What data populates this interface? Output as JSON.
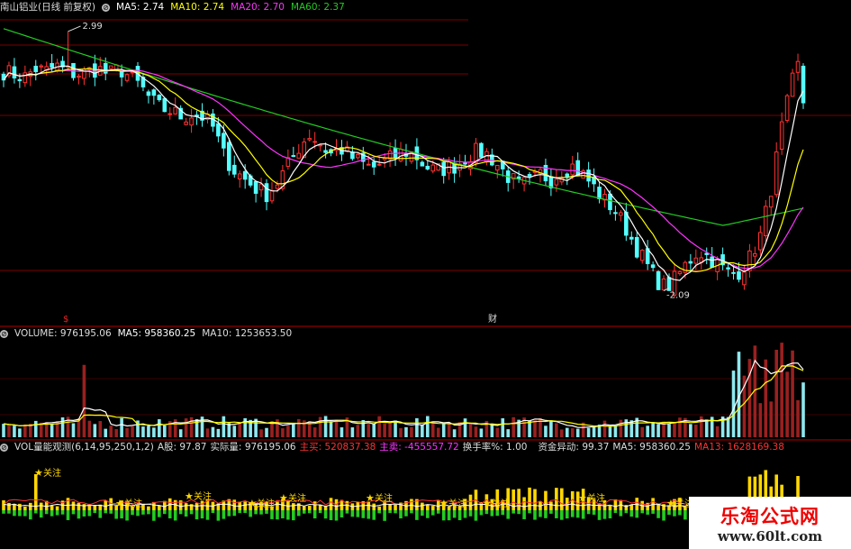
{
  "header_main": {
    "stock": "南山铝业(日线 前复权)",
    "ma5": "MA5: 2.74",
    "ma10": "MA10: 2.74",
    "ma20": "MA20: 2.70",
    "ma60": "MA60: 2.37"
  },
  "header_volume": {
    "label": "VOLUME: 976195.06",
    "ma5": "MA5: 958360.25",
    "ma10": "MA10: 1253653.50"
  },
  "header_indicator": {
    "label": "VOL量能观测(6,14,95,250,1,2)",
    "a": "A股: 97.87",
    "actual": "实际量: 976195.06",
    "main_buy": "主买: 520837.38",
    "main_sell": "主卖: -455557.72",
    "turnover": "换手率%: 1.00",
    "fund": "资金异动: 99.37",
    "ma5": "MA5: 958360.25",
    "ma13": "MA13: 1628169.38"
  },
  "colors": {
    "up": "#ff3232",
    "down": "#54ffff",
    "ma5": "#ffffff",
    "ma10": "#ffff00",
    "ma20": "#ff33ff",
    "ma60": "#22cc22",
    "grid": "#7a0000",
    "buy": "#ffd700",
    "sell": "#22cc22"
  },
  "chart_data": [
    {
      "type": "candlestick",
      "panel": "price",
      "title": "南山铝业(日线 前复权)",
      "series": [
        {
          "name": "MA5",
          "value": 2.74
        },
        {
          "name": "MA10",
          "value": 2.74
        },
        {
          "name": "MA20",
          "value": 2.7
        },
        {
          "name": "MA60",
          "value": 2.37
        }
      ],
      "annotations": [
        "2.99",
        "2.09",
        "$",
        "财"
      ],
      "close_path": [
        2.85,
        2.84,
        2.83,
        2.86,
        2.85,
        2.87,
        2.85,
        2.84,
        2.85,
        2.86,
        2.84,
        2.86,
        2.83,
        2.8,
        2.75,
        2.72,
        2.71,
        2.69,
        2.7,
        2.69,
        2.65,
        2.55,
        2.5,
        2.47,
        2.44,
        2.42,
        2.46,
        2.52,
        2.58,
        2.63,
        2.6,
        2.56,
        2.58,
        2.55,
        2.53,
        2.51,
        2.53,
        2.55,
        2.57,
        2.56,
        2.52,
        2.5,
        2.51,
        2.52,
        2.55,
        2.57,
        2.56,
        2.52,
        2.48,
        2.45,
        2.46,
        2.49,
        2.47,
        2.5,
        2.52,
        2.49,
        2.45,
        2.4,
        2.37,
        2.31,
        2.24,
        2.18,
        2.12,
        2.09,
        2.13,
        2.18,
        2.22,
        2.2,
        2.17,
        2.14,
        2.15,
        2.2,
        2.28,
        2.45,
        2.66,
        2.82,
        2.92
      ]
    },
    {
      "type": "bar",
      "panel": "volume",
      "series": [
        {
          "name": "VOLUME",
          "value": 976195.06
        },
        {
          "name": "MA5",
          "value": 958360.25
        },
        {
          "name": "MA10",
          "value": 1253653.5
        }
      ]
    },
    {
      "type": "bar",
      "panel": "indicator",
      "title": "VOL量能观测(6,14,95,250,1,2)",
      "annotations": [
        "关注"
      ],
      "series": [
        {
          "name": "主买",
          "value": 520837.38
        },
        {
          "name": "主卖",
          "value": -455557.72
        }
      ]
    }
  ],
  "logo": {
    "title": "乐淘公式网",
    "url": "www.60lt.com"
  }
}
